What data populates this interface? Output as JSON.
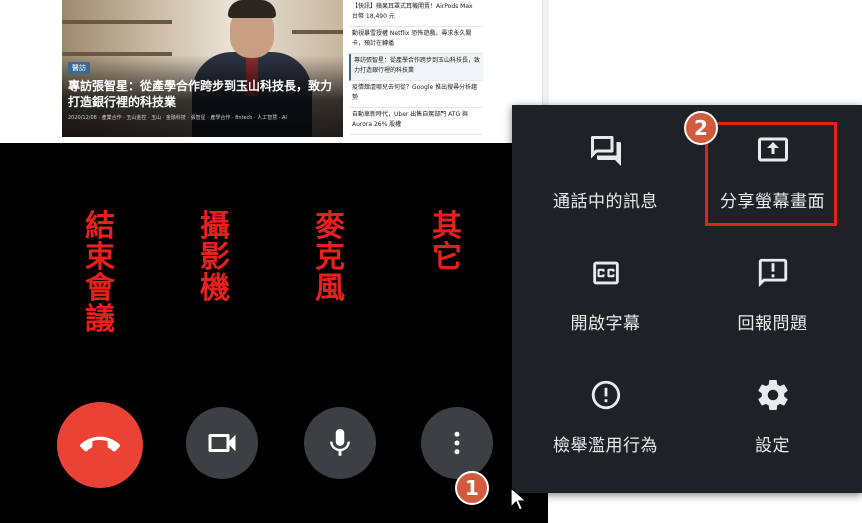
{
  "article": {
    "hero_tag": "醫訪",
    "hero_title": "專訪張智星：從產學合作跨步到玉山科技長，致力打造銀行裡的科技業",
    "hero_meta": "2020/12/08 · 產業合作 · 玉山金控 · 玉山 · 金融科技 · 張智星 · 產學合作 · fintech · 人工智慧 · AI",
    "news_items": [
      "【快訊】蘋果耳罩式耳機開賣！AirPods Max 台幣 18,490 元",
      "動視暴雪授權 Netflix 恐怖遊戲，尋求永久關卡，預計在轉播",
      "專訪張智星：從產學合作跨步到玉山科技長，致力打造銀行裡的科技業",
      "疫情肆虐哪兒去何從？Google 推出搜尋分析趨勢",
      "自動車新時代，Uber 出售自駕部門 ATG 與 Aurora 26% 股權"
    ]
  },
  "meeting": {
    "labels": {
      "end": "結束會議",
      "camera": "攝影機",
      "mic": "麥克風",
      "other": "其它"
    },
    "badge_1": "1",
    "badge_2": "2"
  },
  "menu": {
    "items": [
      {
        "label": "通話中的訊息",
        "icon": "chat-icon"
      },
      {
        "label": "分享螢幕畫面",
        "icon": "present-screen-icon"
      },
      {
        "label": "開啟字幕",
        "icon": "captions-icon"
      },
      {
        "label": "回報問題",
        "icon": "feedback-icon"
      },
      {
        "label": "檢舉濫用行為",
        "icon": "report-abuse-icon"
      },
      {
        "label": "設定",
        "icon": "settings-gear-icon"
      }
    ]
  },
  "colors": {
    "end_call": "#ea4335",
    "control_bg": "#3c4043",
    "menu_bg": "#202124",
    "annotation_red": "#e8201d",
    "badge": "#d45a3d"
  }
}
